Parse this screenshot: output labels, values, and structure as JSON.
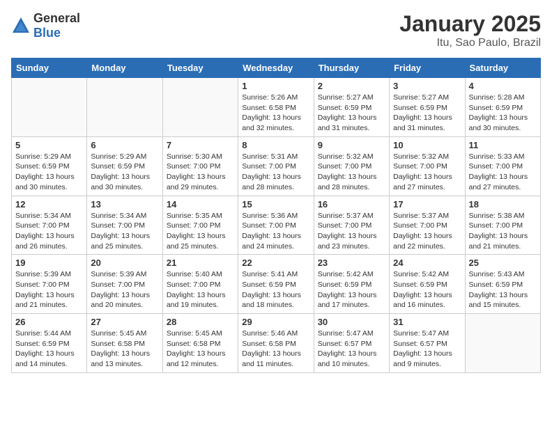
{
  "header": {
    "logo_general": "General",
    "logo_blue": "Blue",
    "month": "January 2025",
    "location": "Itu, Sao Paulo, Brazil"
  },
  "days_of_week": [
    "Sunday",
    "Monday",
    "Tuesday",
    "Wednesday",
    "Thursday",
    "Friday",
    "Saturday"
  ],
  "weeks": [
    [
      {
        "day": "",
        "info": ""
      },
      {
        "day": "",
        "info": ""
      },
      {
        "day": "",
        "info": ""
      },
      {
        "day": "1",
        "info": "Sunrise: 5:26 AM\nSunset: 6:58 PM\nDaylight: 13 hours\nand 32 minutes."
      },
      {
        "day": "2",
        "info": "Sunrise: 5:27 AM\nSunset: 6:59 PM\nDaylight: 13 hours\nand 31 minutes."
      },
      {
        "day": "3",
        "info": "Sunrise: 5:27 AM\nSunset: 6:59 PM\nDaylight: 13 hours\nand 31 minutes."
      },
      {
        "day": "4",
        "info": "Sunrise: 5:28 AM\nSunset: 6:59 PM\nDaylight: 13 hours\nand 30 minutes."
      }
    ],
    [
      {
        "day": "5",
        "info": "Sunrise: 5:29 AM\nSunset: 6:59 PM\nDaylight: 13 hours\nand 30 minutes."
      },
      {
        "day": "6",
        "info": "Sunrise: 5:29 AM\nSunset: 6:59 PM\nDaylight: 13 hours\nand 30 minutes."
      },
      {
        "day": "7",
        "info": "Sunrise: 5:30 AM\nSunset: 7:00 PM\nDaylight: 13 hours\nand 29 minutes."
      },
      {
        "day": "8",
        "info": "Sunrise: 5:31 AM\nSunset: 7:00 PM\nDaylight: 13 hours\nand 28 minutes."
      },
      {
        "day": "9",
        "info": "Sunrise: 5:32 AM\nSunset: 7:00 PM\nDaylight: 13 hours\nand 28 minutes."
      },
      {
        "day": "10",
        "info": "Sunrise: 5:32 AM\nSunset: 7:00 PM\nDaylight: 13 hours\nand 27 minutes."
      },
      {
        "day": "11",
        "info": "Sunrise: 5:33 AM\nSunset: 7:00 PM\nDaylight: 13 hours\nand 27 minutes."
      }
    ],
    [
      {
        "day": "12",
        "info": "Sunrise: 5:34 AM\nSunset: 7:00 PM\nDaylight: 13 hours\nand 26 minutes."
      },
      {
        "day": "13",
        "info": "Sunrise: 5:34 AM\nSunset: 7:00 PM\nDaylight: 13 hours\nand 25 minutes."
      },
      {
        "day": "14",
        "info": "Sunrise: 5:35 AM\nSunset: 7:00 PM\nDaylight: 13 hours\nand 25 minutes."
      },
      {
        "day": "15",
        "info": "Sunrise: 5:36 AM\nSunset: 7:00 PM\nDaylight: 13 hours\nand 24 minutes."
      },
      {
        "day": "16",
        "info": "Sunrise: 5:37 AM\nSunset: 7:00 PM\nDaylight: 13 hours\nand 23 minutes."
      },
      {
        "day": "17",
        "info": "Sunrise: 5:37 AM\nSunset: 7:00 PM\nDaylight: 13 hours\nand 22 minutes."
      },
      {
        "day": "18",
        "info": "Sunrise: 5:38 AM\nSunset: 7:00 PM\nDaylight: 13 hours\nand 21 minutes."
      }
    ],
    [
      {
        "day": "19",
        "info": "Sunrise: 5:39 AM\nSunset: 7:00 PM\nDaylight: 13 hours\nand 21 minutes."
      },
      {
        "day": "20",
        "info": "Sunrise: 5:39 AM\nSunset: 7:00 PM\nDaylight: 13 hours\nand 20 minutes."
      },
      {
        "day": "21",
        "info": "Sunrise: 5:40 AM\nSunset: 7:00 PM\nDaylight: 13 hours\nand 19 minutes."
      },
      {
        "day": "22",
        "info": "Sunrise: 5:41 AM\nSunset: 6:59 PM\nDaylight: 13 hours\nand 18 minutes."
      },
      {
        "day": "23",
        "info": "Sunrise: 5:42 AM\nSunset: 6:59 PM\nDaylight: 13 hours\nand 17 minutes."
      },
      {
        "day": "24",
        "info": "Sunrise: 5:42 AM\nSunset: 6:59 PM\nDaylight: 13 hours\nand 16 minutes."
      },
      {
        "day": "25",
        "info": "Sunrise: 5:43 AM\nSunset: 6:59 PM\nDaylight: 13 hours\nand 15 minutes."
      }
    ],
    [
      {
        "day": "26",
        "info": "Sunrise: 5:44 AM\nSunset: 6:59 PM\nDaylight: 13 hours\nand 14 minutes."
      },
      {
        "day": "27",
        "info": "Sunrise: 5:45 AM\nSunset: 6:58 PM\nDaylight: 13 hours\nand 13 minutes."
      },
      {
        "day": "28",
        "info": "Sunrise: 5:45 AM\nSunset: 6:58 PM\nDaylight: 13 hours\nand 12 minutes."
      },
      {
        "day": "29",
        "info": "Sunrise: 5:46 AM\nSunset: 6:58 PM\nDaylight: 13 hours\nand 11 minutes."
      },
      {
        "day": "30",
        "info": "Sunrise: 5:47 AM\nSunset: 6:57 PM\nDaylight: 13 hours\nand 10 minutes."
      },
      {
        "day": "31",
        "info": "Sunrise: 5:47 AM\nSunset: 6:57 PM\nDaylight: 13 hours\nand 9 minutes."
      },
      {
        "day": "",
        "info": ""
      }
    ]
  ]
}
